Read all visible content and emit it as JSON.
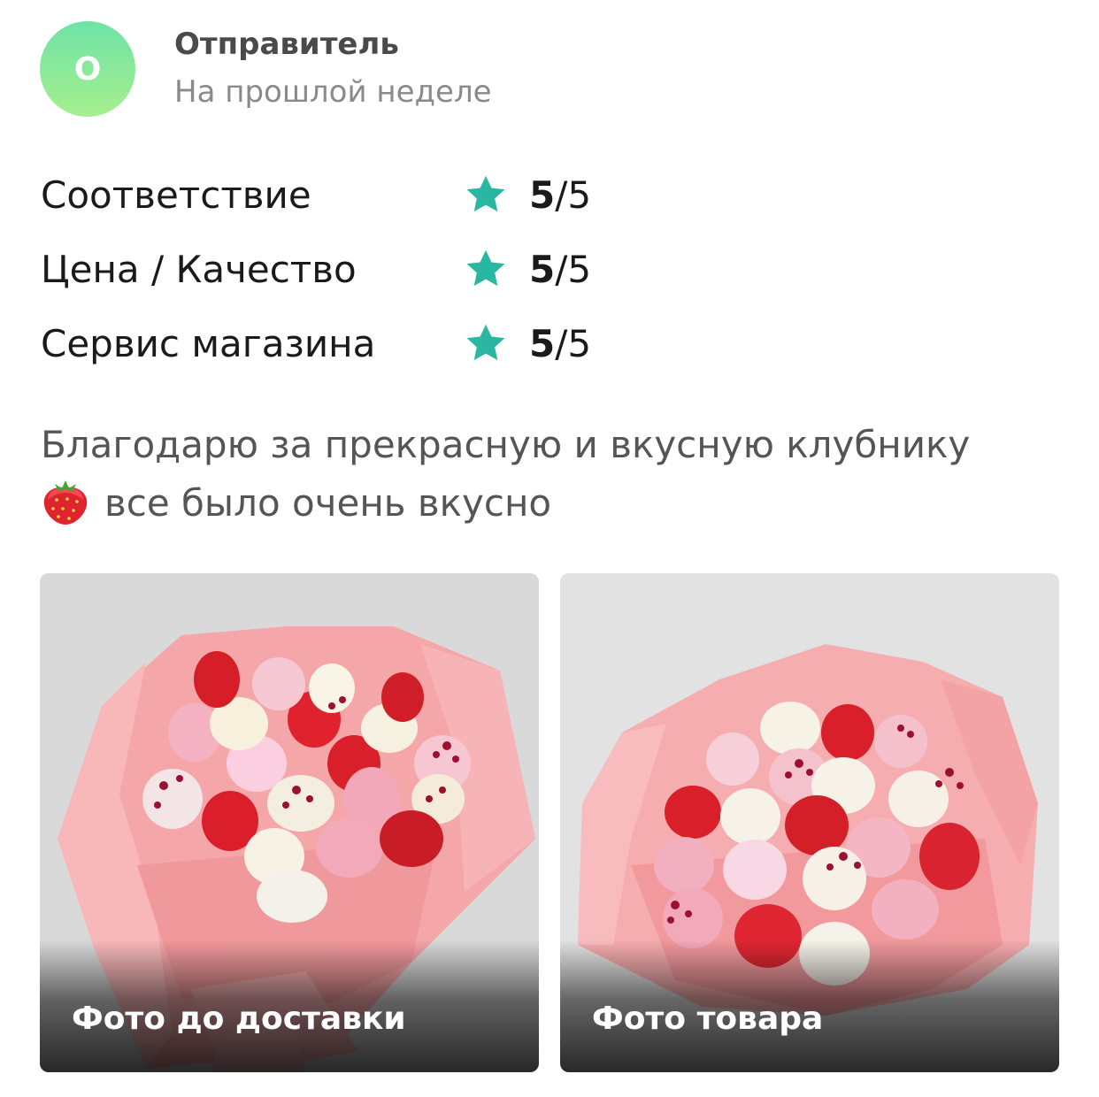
{
  "author": {
    "avatar_letter": "О",
    "name": "Отправитель",
    "date": "На прошлой неделе"
  },
  "ratings": [
    {
      "label": "Соответствие",
      "score": "5",
      "max": "/5"
    },
    {
      "label": "Цена / Качество",
      "score": "5",
      "max": "/5"
    },
    {
      "label": "Сервис магазина",
      "score": "5",
      "max": "/5"
    }
  ],
  "review": {
    "line1": "Благодарю за прекрасную и вкусную клубнику",
    "line2": "все было очень вкусно"
  },
  "photos": [
    {
      "caption": "Фото до доставки"
    },
    {
      "caption": "Фото товара"
    }
  ],
  "colors": {
    "star": "#2ab7a2",
    "avatar_top": "#6ee3a6",
    "avatar_bottom": "#a6ef8e"
  },
  "icons": {
    "star": "star-icon",
    "berry": "strawberry-emoji-icon"
  }
}
